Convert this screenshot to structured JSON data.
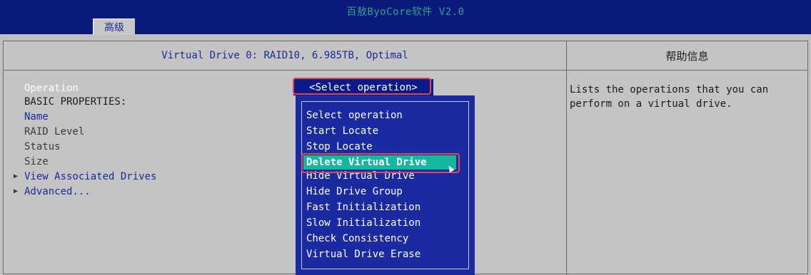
{
  "app": {
    "title": "百敖ByoCore软件 V2.0",
    "active_tab": "高级"
  },
  "header": {
    "drive_title": "Virtual Drive 0: RAID10, 6.985TB, Optimal",
    "help_title": "帮助信息"
  },
  "properties": {
    "operation_label": "Operation",
    "basic_properties_label": "BASIC PROPERTIES:",
    "name_label": "Name",
    "raid_level_label": "RAID Level",
    "status_label": "Status",
    "size_label": "Size",
    "view_associated_drives_label": "View Associated Drives",
    "advanced_label": "Advanced..."
  },
  "operation_select": {
    "current_value": "<Select operation>",
    "options": [
      "Select operation",
      "Start Locate",
      "Stop Locate",
      "Delete Virtual Drive",
      "Hide Virtual Drive",
      "Hide Drive Group",
      "Fast Initialization",
      "Slow Initialization",
      "Check Consistency",
      "Virtual Drive Erase"
    ],
    "highlighted_option": "Delete Virtual Drive"
  },
  "help": {
    "text": "Lists the operations that you can perform on a virtual drive."
  },
  "colors": {
    "bios_blue": "#0a1a7a",
    "dropdown_blue": "#1a2aa0",
    "selection_teal": "#14b8a0",
    "highlight_red": "#e0484a",
    "panel_gray": "#c4c4c4"
  }
}
